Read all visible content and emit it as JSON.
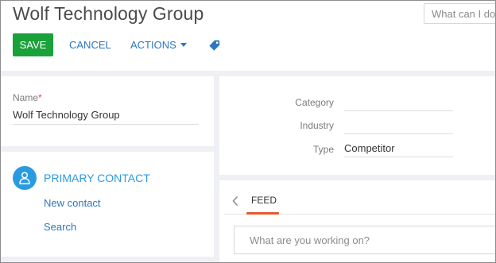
{
  "header": {
    "title": "Wolf Technology Group",
    "search_placeholder": "What can I do for you?"
  },
  "toolbar": {
    "save_label": "SAVE",
    "cancel_label": "CANCEL",
    "actions_label": "ACTIONS",
    "tag_icon": "tag-icon"
  },
  "name_panel": {
    "label": "Name",
    "required_mark": "*",
    "value": "Wolf Technology Group"
  },
  "contact_panel": {
    "icon": "person-icon",
    "title": "PRIMARY CONTACT",
    "new_contact_label": "New contact",
    "search_label": "Search"
  },
  "details_panel": {
    "fields": [
      {
        "label": "Category",
        "value": ""
      },
      {
        "label": "Industry",
        "value": ""
      },
      {
        "label": "Type",
        "value": "Competitor"
      }
    ]
  },
  "feed_panel": {
    "tab_label": "FEED",
    "input_placeholder": "What are you working on?"
  },
  "colors": {
    "save_green": "#1aa13a",
    "link_blue": "#2c77c0",
    "accent_blue": "#2a9be0",
    "tab_underline": "#e8582c",
    "required_red": "#e34c3b"
  }
}
